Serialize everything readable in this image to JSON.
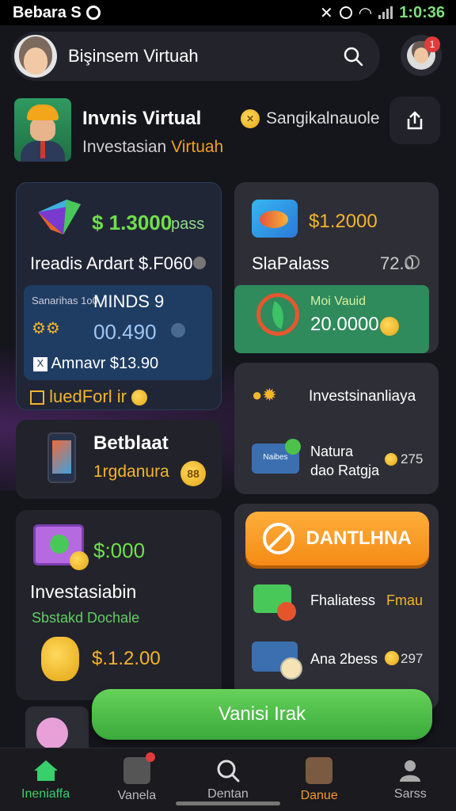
{
  "status_bar": {
    "carrier": "Bebara S",
    "time": "1:0:36"
  },
  "header": {
    "title": "Bişinsem Virtuah",
    "notification_count": "1"
  },
  "profile": {
    "name": "Invnis Virtual",
    "subtitle_a": "Investasian",
    "subtitle_b": "Virtuah",
    "badge_text": "Sangikalnauole"
  },
  "card_blue": {
    "price": "$ 1.3000",
    "price_suffix": "pass",
    "title": "Ireadis Ardart $.F060",
    "inner_label": "Sanarihas\n1o0",
    "inner_title": "MINDS 9",
    "inner_value": "00.490",
    "inner_footer": "Amnavr $13.90",
    "link": "luedForl ir"
  },
  "card_top_right": {
    "price": "$1.2000",
    "title": "SlaPalass",
    "value": "72.0",
    "inner_label": "Moi Vauid",
    "inner_value": "20.0000"
  },
  "card_mid_right": {
    "row1": "Investsinanliaya",
    "row2_line1": "Natura",
    "row2_line2": "dao Ratgja",
    "row2_value": "275",
    "thumb_label": "Naibes"
  },
  "card_mid_left": {
    "title": "Betblaat",
    "subtitle": "1rgdanura"
  },
  "card_bot_left": {
    "price": "$:000",
    "title": "Investasiabin",
    "subtitle": "Sbstakd Dochale",
    "value": "$.1.2.00"
  },
  "card_bot_right": {
    "button": "DANTLHNA",
    "row1": "Fhaliatess",
    "row1_value": "Fmau",
    "row2": "Ana 2bess",
    "row2_value": "297"
  },
  "cta": {
    "label": "Vanisi Irak"
  },
  "bottom_nav": [
    {
      "label": "Ineniaffa"
    },
    {
      "label": "Vanela"
    },
    {
      "label": "Dentan"
    },
    {
      "label": "Danue"
    },
    {
      "label": "Sarss"
    }
  ],
  "colors": {
    "accent_green": "#37d06b",
    "accent_orange": "#f48b16",
    "price_green": "#6fe04a",
    "price_yellow": "#f3b52b"
  }
}
